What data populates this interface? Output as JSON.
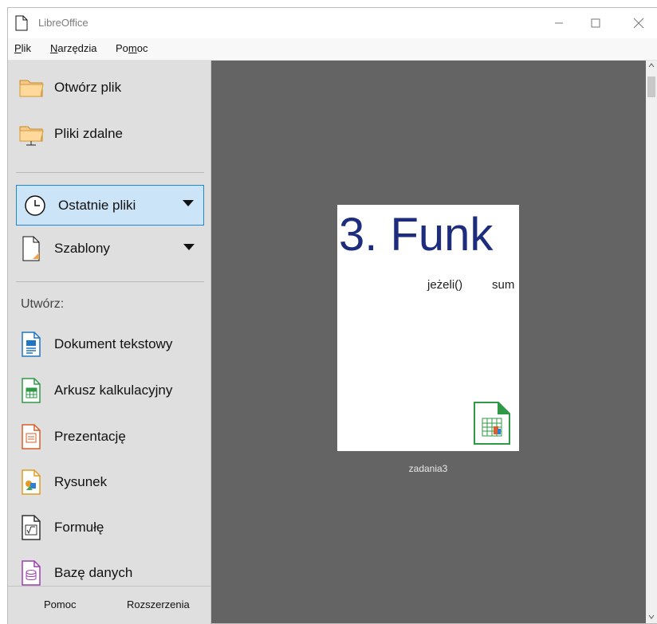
{
  "window": {
    "title": "LibreOffice",
    "minimize_icon": "minimize-icon",
    "maximize_icon": "maximize-icon",
    "close_icon": "close-icon"
  },
  "menu": {
    "items": [
      {
        "label_before": "",
        "mnemonic": "P",
        "label_after": "lik"
      },
      {
        "label_before": "",
        "mnemonic": "N",
        "label_after": "arzędzia"
      },
      {
        "label_before": "Po",
        "mnemonic": "m",
        "label_after": "oc"
      }
    ]
  },
  "sidebar": {
    "open_file": "Otwórz plik",
    "remote_files": "Pliki zdalne",
    "recent_files": "Ostatnie pliki",
    "templates": "Szablony",
    "create_label": "Utwórz:",
    "create_items": [
      {
        "label": "Dokument tekstowy",
        "icon": "writer-document-icon"
      },
      {
        "label": "Arkusz kalkulacyjny",
        "icon": "calc-spreadsheet-icon"
      },
      {
        "label": "Prezentację",
        "icon": "impress-presentation-icon"
      },
      {
        "label": "Rysunek",
        "icon": "draw-drawing-icon"
      },
      {
        "label": "Formułę",
        "icon": "math-formula-icon"
      },
      {
        "label": "Bazę danych",
        "icon": "base-database-icon"
      }
    ],
    "bottom": {
      "help": "Pomoc",
      "extensions": "Rozszerzenia"
    }
  },
  "recent": {
    "thumbnail": {
      "title": "3. Funk",
      "subtitle_left": "jeżeli()",
      "subtitle_right": "sum",
      "name": "zadania3",
      "badge_icon": "calc-spreadsheet-icon"
    }
  },
  "colors": {
    "sidebar": "#dfdfdf",
    "content": "#646464",
    "active_bg": "#cce4f7",
    "active_border": "#1f88d6",
    "title_blue": "#1d2c7c"
  }
}
